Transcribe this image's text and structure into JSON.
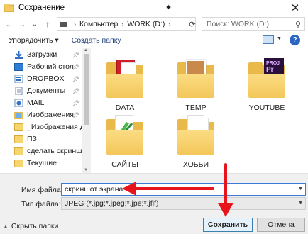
{
  "window": {
    "title": "Сохранение",
    "close_glyph": "✕"
  },
  "nav": {
    "back": "←",
    "forward": "→",
    "recent": "⌄",
    "up": "↑",
    "path": [
      "Компьютер",
      "WORK (D:)"
    ],
    "path_sep": "›",
    "search_placeholder": "Поиск: WORK (D:)"
  },
  "toolbar": {
    "organize": "Упорядочить ▾",
    "new_folder": "Создать папку"
  },
  "sidebar": {
    "items": [
      {
        "label": "Загрузки",
        "icon": "download-icon",
        "pinned": true
      },
      {
        "label": "Рабочий стол",
        "icon": "desktop-icon",
        "pinned": true
      },
      {
        "label": "DROPBOX",
        "icon": "dropbox-icon",
        "pinned": true
      },
      {
        "label": "Документы",
        "icon": "documents-icon",
        "pinned": true
      },
      {
        "label": "MAIL",
        "icon": "mail-icon",
        "pinned": true
      },
      {
        "label": "Изображения",
        "icon": "pictures-icon",
        "pinned": true
      },
      {
        "label": "_Изображения для",
        "icon": "folder-icon",
        "pinned": false
      },
      {
        "label": "ПЗ",
        "icon": "folder-icon",
        "pinned": false
      },
      {
        "label": "сделать скриншот",
        "icon": "folder-icon",
        "pinned": false
      },
      {
        "label": "Текущие",
        "icon": "folder-icon",
        "pinned": false
      }
    ]
  },
  "files": [
    {
      "name": "DATA",
      "icon": "folder-pdf-icon"
    },
    {
      "name": "TEMP",
      "icon": "folder-photo-icon"
    },
    {
      "name": "YOUTUBE",
      "icon": "folder-premiere-icon"
    },
    {
      "name": "САЙТЫ",
      "icon": "folder-paint-icon"
    },
    {
      "name": "ХОББИ",
      "icon": "folder-docs-icon"
    }
  ],
  "form": {
    "filename_label": "Имя файла:",
    "filename_value": "скриншот экрана",
    "filetype_label": "Тип файла:",
    "filetype_value": "JPEG (*.jpg;*.jpeg;*.jpe;*.jfif)"
  },
  "buttons": {
    "hide_folders": "Скрыть папки",
    "save": "Сохранить",
    "cancel": "Отмена"
  },
  "badges": {
    "premiere_text": "PROJ",
    "premiere_logo": "Pr"
  },
  "colors": {
    "annotation_arrow": "#e8141c",
    "accent": "#3b7bd6"
  }
}
